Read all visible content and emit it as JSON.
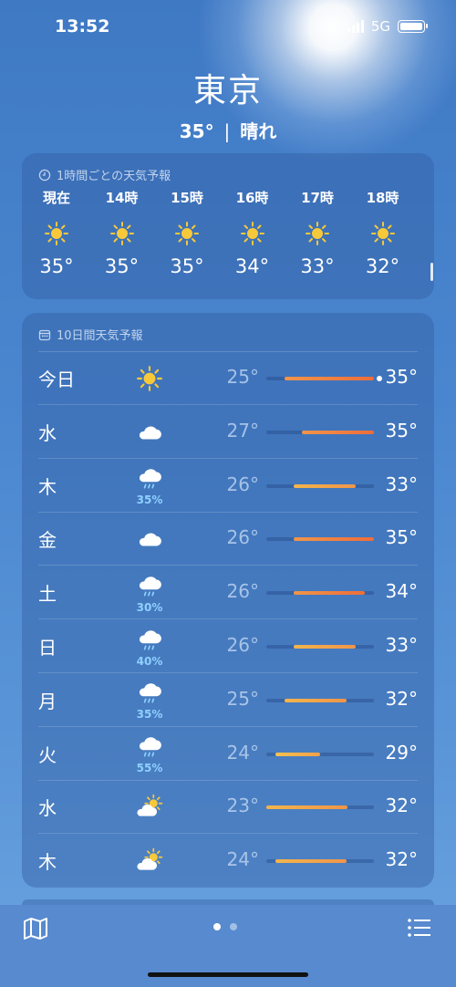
{
  "status": {
    "time": "13:52",
    "network": "5G"
  },
  "location": {
    "city": "東京",
    "current_temp": "35°",
    "separator": "|",
    "condition": "晴れ"
  },
  "hourly": {
    "title": "1時間ごとの天気予報",
    "items": [
      {
        "label": "現在",
        "icon": "sun-icon",
        "temp": "35°"
      },
      {
        "label": "14時",
        "icon": "sun-icon",
        "temp": "35°"
      },
      {
        "label": "15時",
        "icon": "sun-icon",
        "temp": "35°"
      },
      {
        "label": "16時",
        "icon": "sun-icon",
        "temp": "34°"
      },
      {
        "label": "17時",
        "icon": "sun-icon",
        "temp": "33°"
      },
      {
        "label": "18時",
        "icon": "sun-icon",
        "temp": "32°"
      }
    ]
  },
  "daily": {
    "title": "10日間天気予報",
    "range_min": 23,
    "range_max": 35,
    "items": [
      {
        "day": "今日",
        "icon": "sun-icon",
        "pop": "",
        "low": "25°",
        "high": "35°",
        "lo_val": 25,
        "hi_val": 35,
        "current": 35
      },
      {
        "day": "水",
        "icon": "cloud-icon",
        "pop": "",
        "low": "27°",
        "high": "35°",
        "lo_val": 27,
        "hi_val": 35
      },
      {
        "day": "木",
        "icon": "rain-icon",
        "pop": "35%",
        "low": "26°",
        "high": "33°",
        "lo_val": 26,
        "hi_val": 33
      },
      {
        "day": "金",
        "icon": "cloud-icon",
        "pop": "",
        "low": "26°",
        "high": "35°",
        "lo_val": 26,
        "hi_val": 35
      },
      {
        "day": "土",
        "icon": "rain-icon",
        "pop": "30%",
        "low": "26°",
        "high": "34°",
        "lo_val": 26,
        "hi_val": 34
      },
      {
        "day": "日",
        "icon": "rain-icon",
        "pop": "40%",
        "low": "26°",
        "high": "33°",
        "lo_val": 26,
        "hi_val": 33
      },
      {
        "day": "月",
        "icon": "rain-icon",
        "pop": "35%",
        "low": "25°",
        "high": "32°",
        "lo_val": 25,
        "hi_val": 32
      },
      {
        "day": "火",
        "icon": "rain-icon",
        "pop": "55%",
        "low": "24°",
        "high": "29°",
        "lo_val": 24,
        "hi_val": 29
      },
      {
        "day": "水",
        "icon": "partly-cloudy-icon",
        "pop": "",
        "low": "23°",
        "high": "32°",
        "lo_val": 23,
        "hi_val": 32
      },
      {
        "day": "木",
        "icon": "partly-cloudy-icon",
        "pop": "",
        "low": "24°",
        "high": "32°",
        "lo_val": 24,
        "hi_val": 32
      }
    ]
  },
  "colors": {
    "sun": "#f7c93a",
    "bar_warm": "#f0954a",
    "bar_hot": "#ee6d3a",
    "bar_mild": "#f3b54b",
    "pop": "#8fd0ff"
  },
  "toolbar": {
    "map_icon": "map-icon",
    "list_icon": "list-icon",
    "page_count": 2,
    "active_page": 1
  }
}
